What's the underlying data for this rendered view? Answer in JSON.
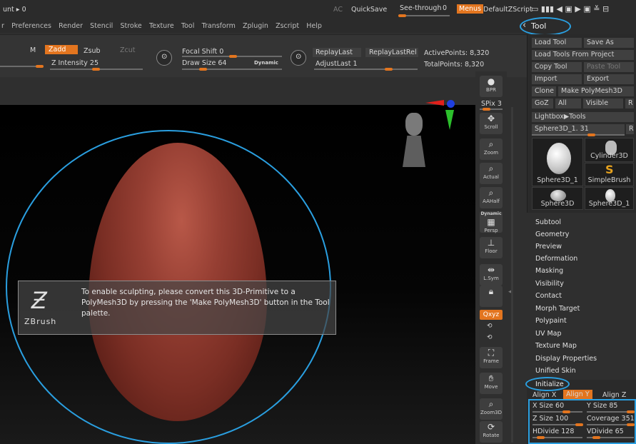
{
  "topbar": {
    "left_text": "unt ▸ 0",
    "ac": "AC",
    "quicksave": "QuickSave",
    "seethrough": "See-through",
    "seethrough_value": "0",
    "menus": "Menus",
    "default_zscript": "DefaultZScript"
  },
  "menubar": {
    "items": [
      "r",
      "Preferences",
      "Render",
      "Stencil",
      "Stroke",
      "Texture",
      "Tool",
      "Transform",
      "Zplugin",
      "Zscript",
      "Help"
    ]
  },
  "toolbar": {
    "m": "M",
    "zadd": "Zadd",
    "zsub": "Zsub",
    "zcut": "Zcut",
    "z_intensity": "Z Intensity 25",
    "focal_shift": "Focal Shift 0",
    "draw_size": "Draw Size 64",
    "dynamic": "Dynamic",
    "replay_last": "ReplayLast",
    "replay_last_rel": "ReplayLastRel",
    "adjust_last": "AdjustLast 1",
    "active_points": "ActivePoints: 8,320",
    "total_points": "TotalPoints: 8,320"
  },
  "tool_header": "Tool",
  "tool_panel": {
    "load_tool": "Load Tool",
    "save_as": "Save As",
    "load_tools_from_project": "Load Tools From Project",
    "copy_tool": "Copy Tool",
    "paste_tool": "Paste Tool",
    "import": "Import",
    "export": "Export",
    "clone": "Clone",
    "make_polymesh": "Make PolyMesh3D",
    "goz": "GoZ",
    "all": "All",
    "visible": "Visible",
    "r": "R",
    "lightbox_tools": "Lightbox▶Tools",
    "current_tool": "Sphere3D_1. 31",
    "thumbs": [
      "Sphere3D_1",
      "Cylinder3D",
      "SimpleBrush",
      "Sphere3D",
      "Sphere3D_1"
    ]
  },
  "sections": [
    "Subtool",
    "Geometry",
    "Preview",
    "Deformation",
    "Masking",
    "Visibility",
    "Contact",
    "Morph Target",
    "Polypaint",
    "UV Map",
    "Texture Map",
    "Display Properties",
    "Unified Skin",
    "Initialize"
  ],
  "initialize": {
    "align_x": "Align X",
    "align_y": "Align Y",
    "align_z": "Align Z",
    "x_size": "X Size 60",
    "y_size": "Y Size 85",
    "z_size": "Z Size 100",
    "coverage": "Coverage 351",
    "hdivide": "HDivide 128",
    "vdivide": "VDivide 65"
  },
  "icon_column": {
    "bpr": "BPR",
    "spix": "SPix 3",
    "scroll": "Scroll",
    "zoom": "Zoom",
    "actual": "Actual",
    "aahalf": "AAHalf",
    "dynamic": "Dynamic",
    "persp": "Persp",
    "floor": "Floor",
    "lsym": "L.Sym",
    "xyz": "Qxyz",
    "frame": "Frame",
    "move": "Move",
    "zoom3d": "Zoom3D",
    "rotate": "Rotate"
  },
  "message": {
    "text": "To enable sculpting, please convert this 3D-Primitive to a PolyMesh3D by pressing the 'Make PolyMesh3D' button in the Tool palette.",
    "logo": "ZBrush"
  },
  "colors": {
    "accent": "#e3751f",
    "highlight_ring": "#2a9fe0"
  }
}
